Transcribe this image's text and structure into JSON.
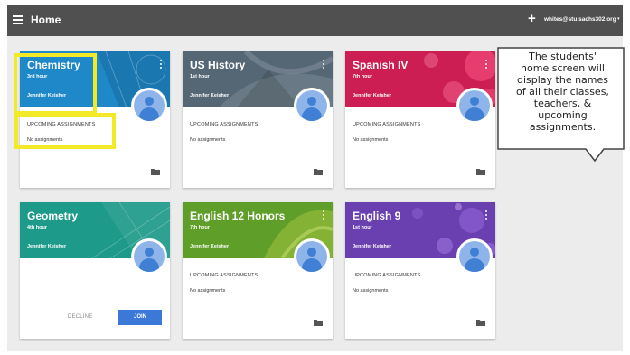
{
  "header": {
    "title": "Home",
    "email": "whites@stu.sachs302.org",
    "plus_symbol": "+",
    "caret_symbol": "▾"
  },
  "classes": [
    {
      "name": "Chemistry",
      "period": "3rd hour",
      "teacher": "Jennifer Keisher",
      "upcoming_label": "UPCOMING ASSIGNMENTS",
      "assignments": "No assignments",
      "color": "#1e88c8"
    },
    {
      "name": "US History",
      "period": "1st hour",
      "teacher": "Jennifer Keisher",
      "upcoming_label": "UPCOMING ASSIGNMENTS",
      "assignments": "No assignments",
      "color": "#556775"
    },
    {
      "name": "Spanish IV",
      "period": "7th hour",
      "teacher": "Jennifer Keisher",
      "upcoming_label": "UPCOMING ASSIGNMENTS",
      "assignments": "No assignments",
      "color": "#cc1e52"
    },
    {
      "name": "Geometry",
      "period": "4th hour",
      "teacher": "Jennifer Keisher",
      "decline_label": "DECLINE",
      "join_label": "JOIN",
      "color": "#1e9a8a"
    },
    {
      "name": "English 12 Honors",
      "period": "7th hour",
      "teacher": "Jennifer Keisher",
      "upcoming_label": "UPCOMING ASSIGNMENTS",
      "assignments": "No assignments",
      "color": "#5f9e28"
    },
    {
      "name": "English 9",
      "period": "1st hour",
      "teacher": "Jennifer Keisher",
      "upcoming_label": "UPCOMING ASSIGNMENTS",
      "assignments": "No assignments",
      "color": "#6a3fb0"
    }
  ],
  "callout": {
    "lines": [
      "The students'",
      "home screen will",
      "display the names",
      "of all their classes,",
      "teachers, &",
      "upcoming",
      "assignments."
    ]
  },
  "colors": {
    "topbar": "#505050",
    "highlight": "#f3ea27",
    "join_button": "#3b78d8",
    "avatar": "#8fb4ea"
  },
  "icons": {
    "menu": "hamburger-menu-icon",
    "add": "plus-icon",
    "more": "vertical-more-icon",
    "folder": "folder-icon",
    "avatar": "person-avatar-icon"
  }
}
